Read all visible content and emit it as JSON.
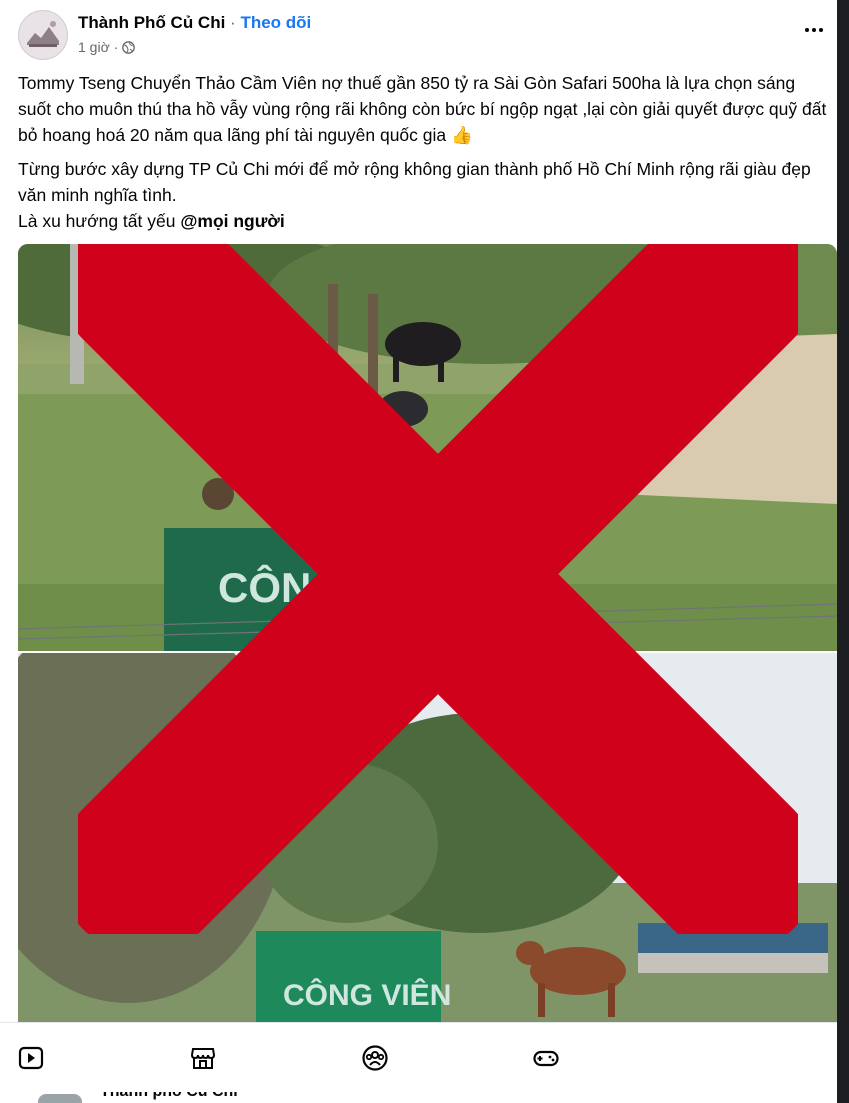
{
  "post": {
    "page_name": "Thành Phố Củ Chi",
    "separator": " · ",
    "follow_label": "Theo dõi",
    "time": "1 giờ",
    "time_separator": "·",
    "paragraph1": "Tommy Tseng Chuyển Thảo Cầm Viên nợ thuế gần 850 tỷ ra Sài Gòn Safari 500ha là lựa chọn sáng suốt cho muôn thú tha hồ vẫy vùng rộng rãi không còn bức bí ngộp ngạt ,lại còn giải quyết được quỹ đất bỏ hoang hoá 20 năm qua lãng phí tài nguyên quốc gia 👍",
    "paragraph2_line1": "Từng bước xây dựng TP Củ Chi mới để mở rộng không gian thành phố Hồ Chí Minh rộng rãi giàu đẹp văn minh nghĩa tình.",
    "paragraph2_line2_prefix": "Là xu hướng tất yếu ",
    "mention": "@mọi người"
  },
  "media": {
    "photo1_sign": "CÔNG",
    "photo2_sign": "CÔNG VIÊN",
    "overlay_color": "#d0021b"
  },
  "bottom_nav": {
    "icons": [
      "video-icon",
      "marketplace-icon",
      "groups-icon",
      "gaming-icon"
    ]
  },
  "next_post": {
    "page_name": "Thành phố Củ Chi"
  }
}
